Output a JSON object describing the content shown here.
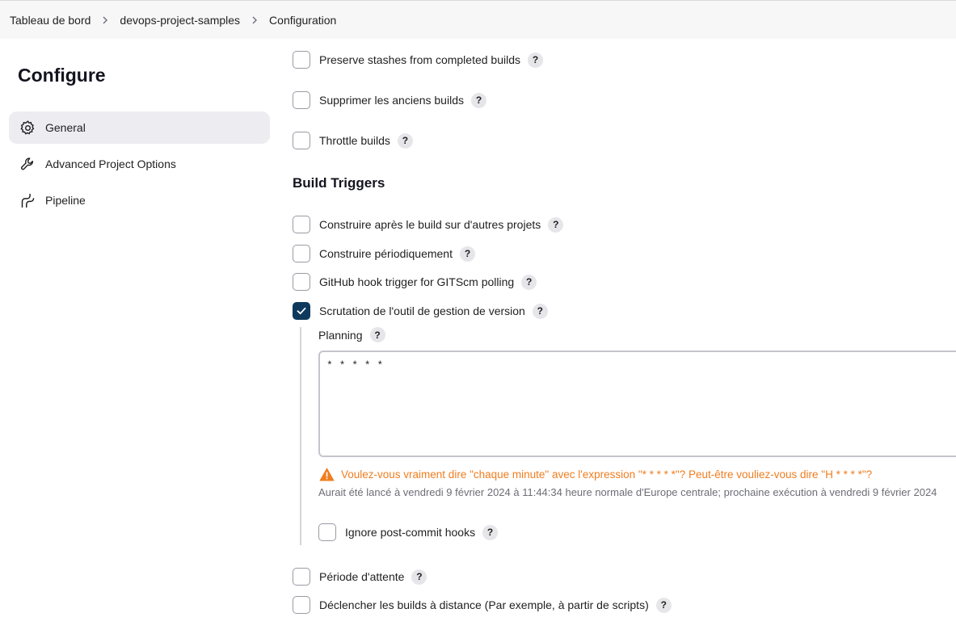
{
  "breadcrumb": [
    "Tableau de bord",
    "devops-project-samples",
    "Configuration"
  ],
  "sidebar": {
    "title": "Configure",
    "items": [
      {
        "label": "General",
        "icon": "gear-icon",
        "active": true
      },
      {
        "label": "Advanced Project Options",
        "icon": "wrench-icon",
        "active": false
      },
      {
        "label": "Pipeline",
        "icon": "pipeline-icon",
        "active": false
      }
    ]
  },
  "options": {
    "preserve_stashes": {
      "label": "Preserve stashes from completed builds",
      "checked": false
    },
    "discard_old": {
      "label": "Supprimer les anciens builds",
      "checked": false
    },
    "throttle": {
      "label": "Throttle builds",
      "checked": false
    }
  },
  "build_triggers": {
    "title": "Build Triggers",
    "after_other": {
      "label": "Construire après le build sur d'autres projets",
      "checked": false
    },
    "periodic": {
      "label": "Construire périodiquement",
      "checked": false
    },
    "github_hook": {
      "label": "GitHub hook trigger for GITScm polling",
      "checked": false
    },
    "scm_polling": {
      "label": "Scrutation de l'outil de gestion de version",
      "checked": true
    },
    "planning_label": "Planning",
    "schedule_value": "* * * * *",
    "warning": "Voulez-vous vraiment dire \"chaque minute\" avec l'expression  \"* * * * *\"? Peut-être vouliez-vous dire \"H * * * *\"?",
    "info": "Aurait été lancé à vendredi 9 février 2024 à 11:44:34 heure normale d'Europe centrale; prochaine exécution à vendredi 9 février 2024",
    "ignore_hooks": {
      "label": "Ignore post-commit hooks",
      "checked": false
    },
    "quiet_period": {
      "label": "Période d'attente",
      "checked": false
    },
    "remote_trigger": {
      "label": "Déclencher les builds à distance (Par exemple, à partir de scripts)",
      "checked": false
    }
  },
  "help_symbol": "?",
  "colors": {
    "checkbox_checked": "#0d3a5c",
    "warning": "#f07d1f",
    "active_nav": "#ececf1"
  }
}
